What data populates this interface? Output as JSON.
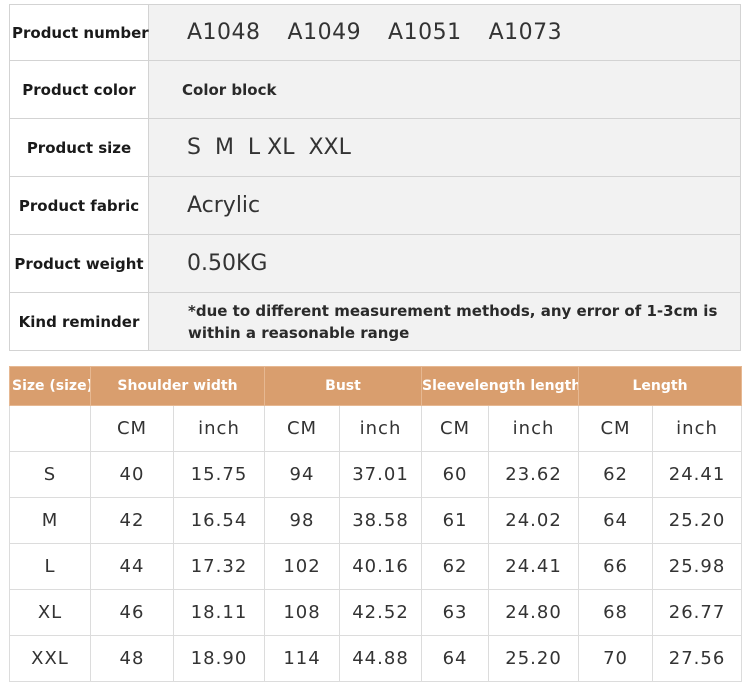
{
  "product_info": [
    {
      "label": "Product number",
      "value": "A1048  A1049  A1051  A1073"
    },
    {
      "label": "Product color",
      "value": "Color block"
    },
    {
      "label": "Product size",
      "value": "S  M  L XL  XXL"
    },
    {
      "label": "Product fabric",
      "value": "Acrylic"
    },
    {
      "label": "Product weight",
      "value": "0.50KG"
    },
    {
      "label": "Kind reminder",
      "value": "*due to different measurement methods, any error of 1-3cm is within a reasonable range"
    }
  ],
  "size_table": {
    "header_color": "#d99e6e",
    "headers": [
      "Size (size)",
      "Shoulder  width",
      "Bust",
      "Sleevelength length",
      "Length"
    ],
    "units": [
      "CM",
      "inch",
      "CM",
      "inch",
      "CM",
      "inch",
      "CM",
      "inch"
    ],
    "rows": [
      [
        "S",
        "40",
        "15.75",
        "94",
        "37.01",
        "60",
        "23.62",
        "62",
        "24.41"
      ],
      [
        "M",
        "42",
        "16.54",
        "98",
        "38.58",
        "61",
        "24.02",
        "64",
        "25.20"
      ],
      [
        "L",
        "44",
        "17.32",
        "102",
        "40.16",
        "62",
        "24.41",
        "66",
        "25.98"
      ],
      [
        "XL",
        "46",
        "18.11",
        "108",
        "42.52",
        "63",
        "24.80",
        "68",
        "26.77"
      ],
      [
        "XXL",
        "48",
        "18.90",
        "114",
        "44.88",
        "64",
        "25.20",
        "70",
        "27.56"
      ]
    ]
  }
}
